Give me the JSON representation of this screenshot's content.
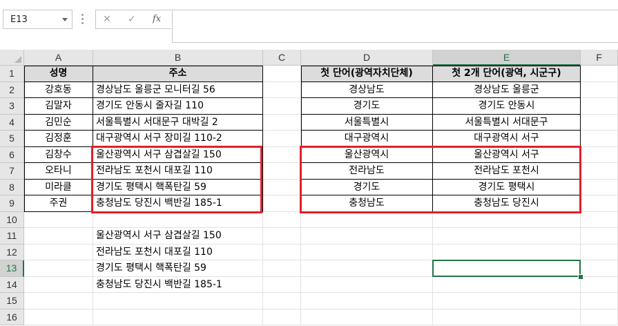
{
  "name_box": "E13",
  "formula_bar": {
    "cancel_icon": "✕",
    "enter_icon": "✓",
    "fx_label": "fx",
    "value": ""
  },
  "columns": [
    "A",
    "B",
    "C",
    "D",
    "E",
    "F"
  ],
  "rows": [
    "1",
    "2",
    "3",
    "4",
    "5",
    "6",
    "7",
    "8",
    "9",
    "10",
    "11",
    "12",
    "13",
    "14",
    "15",
    "16"
  ],
  "selected_cell": "E13",
  "table": {
    "headers": {
      "A": "성명",
      "B": "주소",
      "D": "첫 단어(광역자치단체)",
      "E": "첫 2개 단어(광역, 시군구)"
    },
    "rows": [
      {
        "A": "강호동",
        "B": "경상남도 울릉군 모니터길 56",
        "D": "경상남도",
        "E": "경상남도 울릉군"
      },
      {
        "A": "김말자",
        "B": "경기도 안동시 줄자길 110",
        "D": "경기도",
        "E": "경기도 안동시"
      },
      {
        "A": "김민순",
        "B": "서울특별시 서대문구 대박길 2",
        "D": "서울특별시",
        "E": "서울특별시 서대문구"
      },
      {
        "A": "김정훈",
        "B": "대구광역시 서구 장미길 110-2",
        "D": "대구광역시",
        "E": "대구광역시 서구"
      },
      {
        "A": "김창수",
        "B": "울산광역시 서구 삼겹살길 150",
        "D": "울산광역시",
        "E": "울산광역시 서구"
      },
      {
        "A": "오타니",
        "B": "전라남도 포천시 대포길 110",
        "D": "전라남도",
        "E": "전라남도 포천시"
      },
      {
        "A": "미라클",
        "B": "경기도 평택시 핵폭탄길 59",
        "D": "경기도",
        "E": "경기도 평택시"
      },
      {
        "A": "주권",
        "B": "충청남도 당진시 백반길 185-1",
        "D": "충청남도",
        "E": "충청남도 당진시"
      }
    ]
  },
  "notes": [
    "울산광역시 서구 삼겹살길 150",
    "전라남도 포천시 대포길 110",
    "경기도 평택시 핵폭탄길 59",
    "충청남도 당진시 백반길 185-1"
  ],
  "highlight_color": "#e0202a",
  "selection_color": "#217346"
}
